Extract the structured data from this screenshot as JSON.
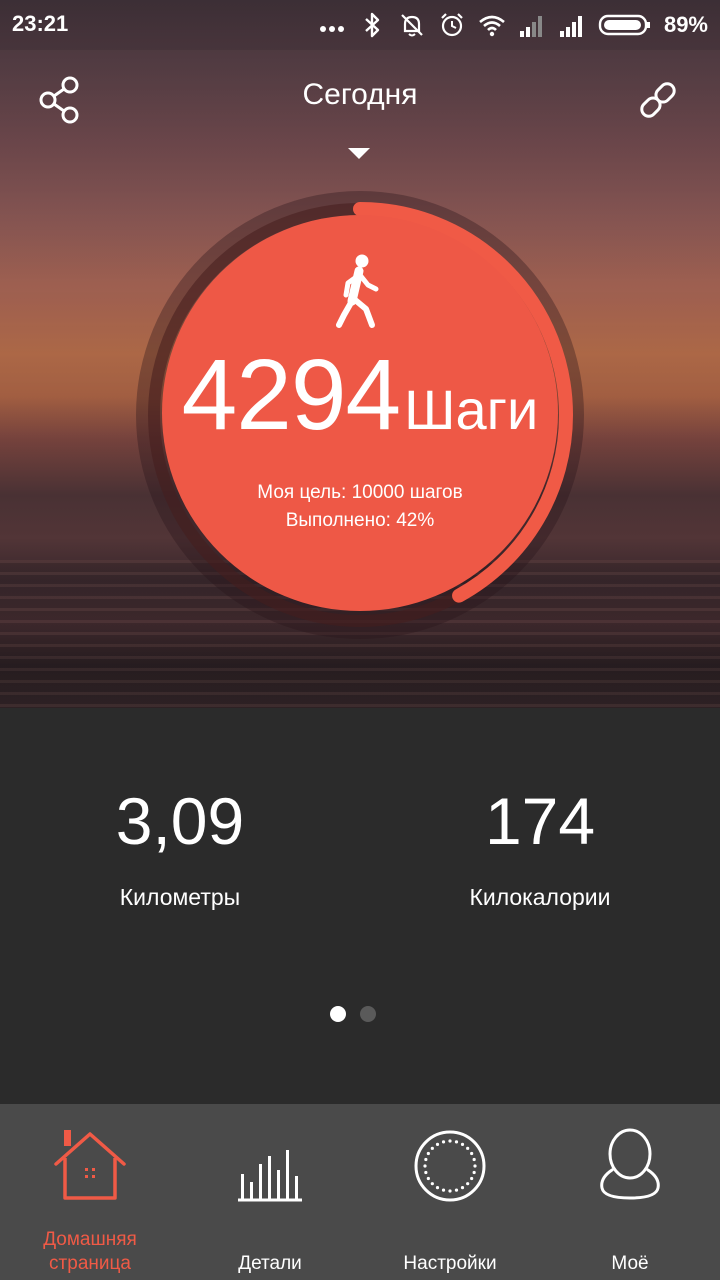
{
  "status_bar": {
    "time": "23:21",
    "battery_percent": "89%",
    "icons": [
      "more-dots-icon",
      "bluetooth-icon",
      "notifications-off-icon",
      "alarm-icon",
      "wifi-icon",
      "signal-1-icon",
      "signal-2-icon",
      "battery-icon"
    ]
  },
  "header": {
    "title": "Сегодня",
    "share_icon": "share-icon",
    "link_icon": "link-icon"
  },
  "activity": {
    "steps": "4294",
    "steps_unit": "Шаги",
    "goal_text": "Моя цель: 10000 шагов",
    "progress_text": "Выполнено: 42%",
    "progress_fraction": 0.42,
    "icon": "walking-person-icon"
  },
  "stats": {
    "distance_value": "3,09",
    "distance_label": "Километры",
    "calories_value": "174",
    "calories_label": "Килокалории",
    "page_count": 2,
    "active_page": 0
  },
  "nav": {
    "items": [
      {
        "label": "Домашняя страница",
        "icon": "home-icon",
        "active": true
      },
      {
        "label": "Детали",
        "icon": "bar-chart-icon",
        "active": false
      },
      {
        "label": "Настройки",
        "icon": "device-watch-icon",
        "active": false
      },
      {
        "label": "Моё",
        "icon": "user-profile-icon",
        "active": false
      }
    ]
  },
  "colors": {
    "accent": "#f05a46",
    "panel": "#2b2b2b",
    "nav_bg": "#4a4a4a"
  }
}
